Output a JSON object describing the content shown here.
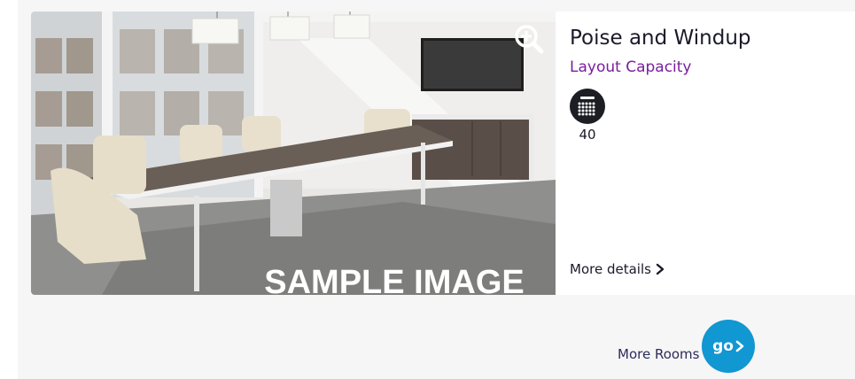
{
  "room": {
    "name": "Poise and Windup",
    "image_watermark": "SAMPLE IMAGE",
    "capacity_heading": "Layout Capacity",
    "layouts": [
      {
        "icon": "theatre-seating-icon",
        "capacity": "40"
      }
    ],
    "more_details_label": "More details"
  },
  "footer": {
    "more_rooms_label": "More Rooms",
    "go_label": "go"
  },
  "colors": {
    "heading_purple": "#7a1e9e",
    "go_button_blue": "#1197d2",
    "icon_dark": "#1d1d24"
  }
}
